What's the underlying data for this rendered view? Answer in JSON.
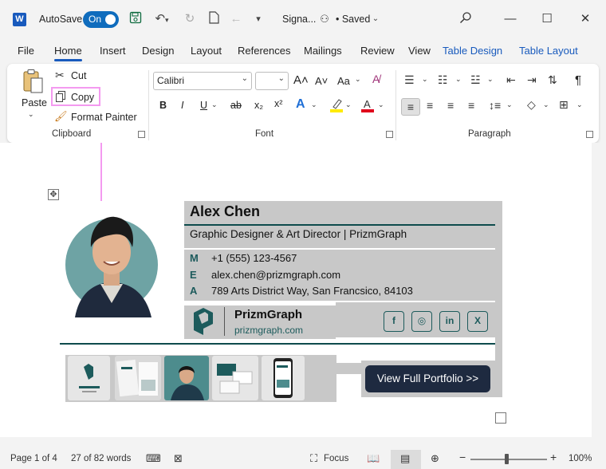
{
  "titlebar": {
    "app_icon": "W",
    "autosave_label": "AutoSave",
    "autosave_state": "On",
    "doc_title": "Signa...",
    "saved_status": "• Saved",
    "icons": [
      "save-icon",
      "undo-icon",
      "redo-icon",
      "new-doc-icon",
      "back-icon",
      "customize-icon",
      "search-icon"
    ]
  },
  "tabs": [
    {
      "label": "File"
    },
    {
      "label": "Home"
    },
    {
      "label": "Insert"
    },
    {
      "label": "Design"
    },
    {
      "label": "Layout"
    },
    {
      "label": "References"
    },
    {
      "label": "Mailings"
    },
    {
      "label": "Review"
    },
    {
      "label": "View"
    },
    {
      "label": "Table Design"
    },
    {
      "label": "Table Layout"
    }
  ],
  "ribbon": {
    "clipboard": {
      "group_label": "Clipboard",
      "paste": "Paste",
      "cut": "Cut",
      "copy": "Copy",
      "format_painter": "Format Painter"
    },
    "font": {
      "group_label": "Font",
      "font_name": "Calibri",
      "font_size": "",
      "bold": "B",
      "italic": "I",
      "underline": "U",
      "strike": "ab",
      "subscript": "x₂",
      "superscript": "x²",
      "grow": "A˄",
      "shrink": "A˅",
      "change_case": "Aa"
    },
    "paragraph": {
      "group_label": "Paragraph",
      "pilcrow": "¶"
    }
  },
  "signature": {
    "name": "Alex Chen",
    "title": "Graphic Designer & Art Director | PrizmGraph",
    "contacts": [
      {
        "letter": "M",
        "value": "+1 (555) 123-4567"
      },
      {
        "letter": "E",
        "value": "alex.chen@prizmgraph.com"
      },
      {
        "letter": "A",
        "value": "789 Arts District Way, San Francsico, 84103"
      }
    ],
    "brand_name": "PrizmGraph",
    "brand_url": "prizmgraph.com",
    "social": [
      "f",
      "◎",
      "in",
      "X"
    ],
    "cta": "View Full Portfolio >>"
  },
  "status": {
    "page": "Page 1 of 4",
    "words": "27 of 82 words",
    "focus": "Focus",
    "zoom": "100%",
    "zoom_level": 1.0
  },
  "colors": {
    "accent": "#185abd",
    "teal": "#0e4b4c",
    "cta_bg": "#1e2a40",
    "highlight": "#f49af0"
  }
}
